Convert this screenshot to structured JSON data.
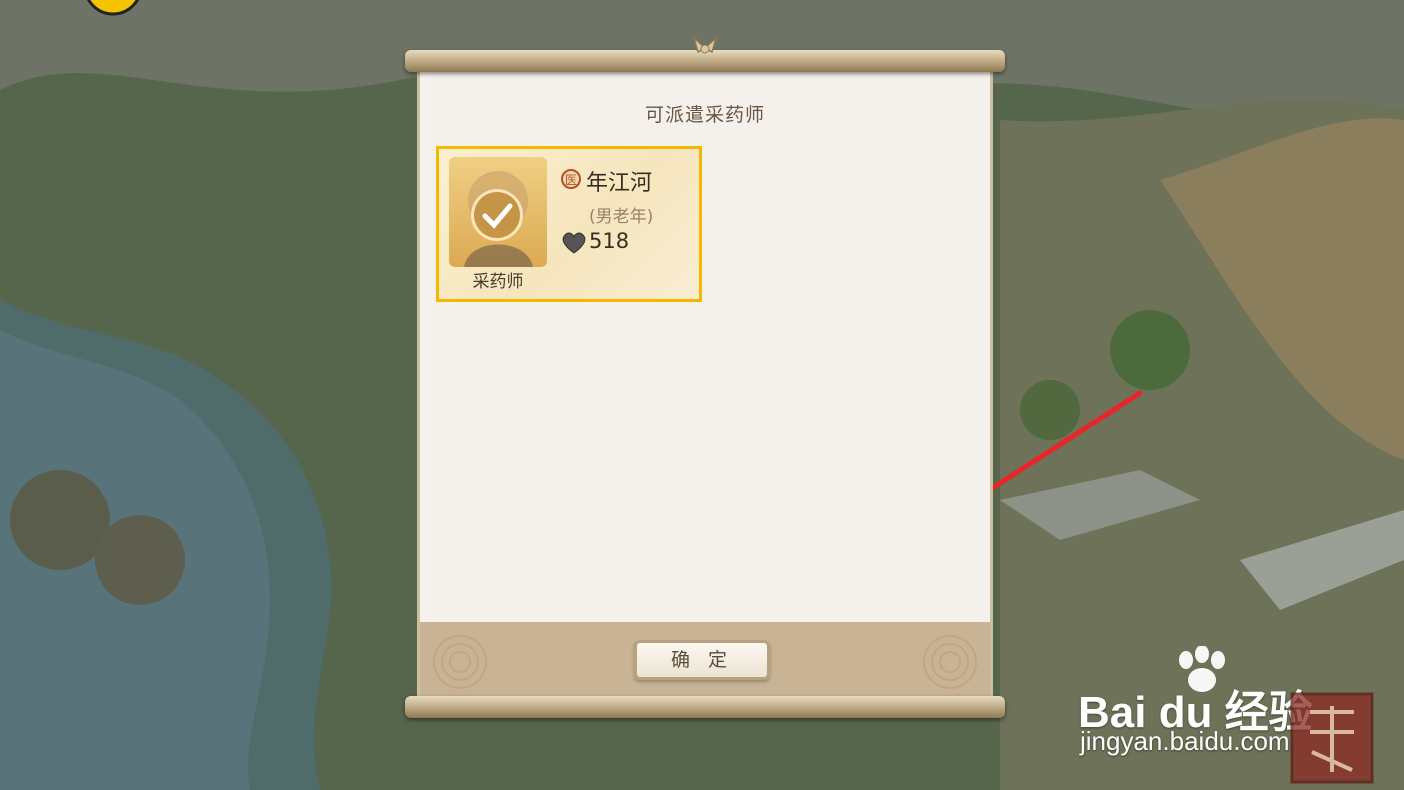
{
  "dialog": {
    "title": "可派遣采药师",
    "confirm_label": "确 定"
  },
  "card": {
    "badge_glyph": "医",
    "name": "年江河",
    "description": "(男老年)",
    "value": "518",
    "role": "采药师",
    "selected": true,
    "icons": [
      "check-icon",
      "heart-icon",
      "medicine-badge-icon"
    ]
  },
  "watermark": {
    "brand": "Bai du 经验",
    "url": "jingyan.baidu.com"
  },
  "colors": {
    "card_border": "#f5b800",
    "arrow": "#e8262a",
    "paper": "#f4f1ed",
    "footer": "#c8b394"
  }
}
